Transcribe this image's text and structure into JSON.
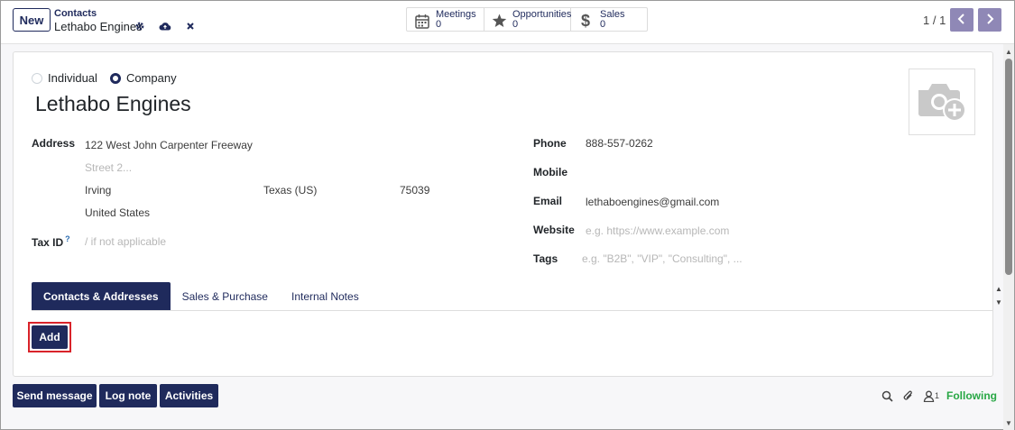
{
  "topbar": {
    "new_label": "New",
    "breadcrumb_parent": "Contacts",
    "breadcrumb_current": "Lethabo Engines",
    "icons": [
      "gear-icon",
      "cloud-upload-icon",
      "close-icon"
    ],
    "smart_buttons": [
      {
        "label": "Meetings",
        "value": "0",
        "icon": "calendar-icon"
      },
      {
        "label": "Opportunities",
        "value": "0",
        "icon": "star-icon"
      },
      {
        "label": "Sales",
        "value": "0",
        "icon": "dollar-icon"
      }
    ],
    "pager": "1 / 1",
    "accent_color": "#8f88b6"
  },
  "form": {
    "company_type": {
      "options": [
        "Individual",
        "Company"
      ],
      "selected": "Company"
    },
    "name": "Lethabo Engines",
    "address": {
      "label": "Address",
      "street": "122 West John Carpenter Freeway",
      "street2_placeholder": "Street 2...",
      "city": "Irving",
      "state": "Texas (US)",
      "zip": "75039",
      "country": "United States"
    },
    "tax_id": {
      "label": "Tax ID",
      "help": "?",
      "placeholder": "/ if not applicable"
    },
    "phone": {
      "label": "Phone",
      "value": "888-557-0262"
    },
    "mobile": {
      "label": "Mobile",
      "value": ""
    },
    "email": {
      "label": "Email",
      "value": "lethaboengines@gmail.com"
    },
    "website": {
      "label": "Website",
      "placeholder": "e.g. https://www.example.com"
    },
    "tags": {
      "label": "Tags",
      "placeholder": "e.g. \"B2B\", \"VIP\", \"Consulting\", ..."
    },
    "tabs": [
      "Contacts & Addresses",
      "Sales & Purchase",
      "Internal Notes"
    ],
    "active_tab": "Contacts & Addresses",
    "add_label": "Add"
  },
  "chatter": {
    "send_message": "Send message",
    "log_note": "Log note",
    "activities": "Activities",
    "follower_count": "1",
    "following": "Following",
    "icons": [
      "search-icon",
      "paperclip-icon",
      "user-icon"
    ]
  },
  "colors": {
    "primary": "#1f2a5c",
    "following": "#28a745",
    "highlight": "#d9232a"
  }
}
